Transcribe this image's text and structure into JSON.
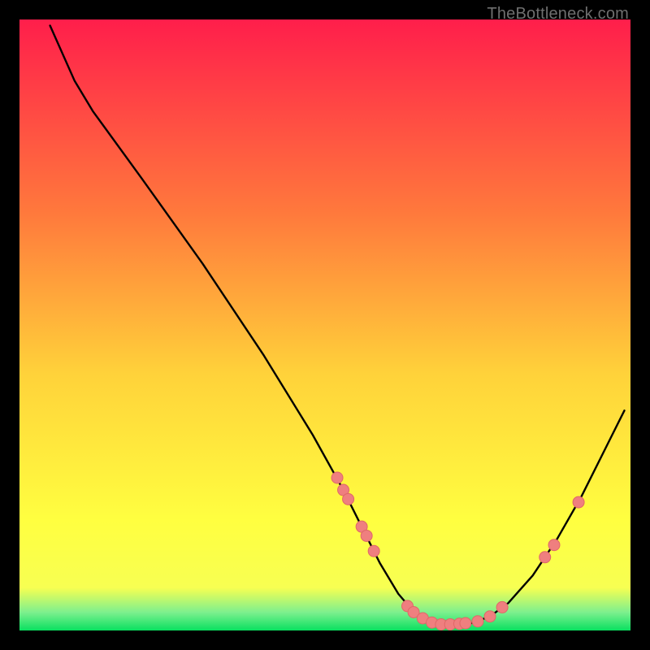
{
  "attribution": "TheBottleneck.com",
  "colors": {
    "top": "#ff1e4b",
    "mid_upper": "#ff7a3c",
    "mid": "#ffd23a",
    "mid_lower": "#ffff40",
    "green": "#09e060",
    "curve": "#000000",
    "marker": "#ef7f7f",
    "marker_stroke": "#e06868",
    "frame_bg": "#000000"
  },
  "chart_data": {
    "type": "line",
    "title": "",
    "xlabel": "",
    "ylabel": "",
    "xlim": [
      0,
      100
    ],
    "ylim": [
      0,
      100
    ],
    "curve": [
      {
        "x": 5.0,
        "y": 99.0
      },
      {
        "x": 9.0,
        "y": 90.0
      },
      {
        "x": 12.0,
        "y": 85.0
      },
      {
        "x": 20.0,
        "y": 74.0
      },
      {
        "x": 30.0,
        "y": 60.0
      },
      {
        "x": 40.0,
        "y": 45.0
      },
      {
        "x": 48.0,
        "y": 32.0
      },
      {
        "x": 53.0,
        "y": 23.0
      },
      {
        "x": 56.0,
        "y": 17.0
      },
      {
        "x": 59.0,
        "y": 11.0
      },
      {
        "x": 62.0,
        "y": 6.0
      },
      {
        "x": 65.0,
        "y": 2.5
      },
      {
        "x": 68.0,
        "y": 1.2
      },
      {
        "x": 71.0,
        "y": 1.0
      },
      {
        "x": 74.0,
        "y": 1.2
      },
      {
        "x": 77.0,
        "y": 2.3
      },
      {
        "x": 80.0,
        "y": 4.5
      },
      {
        "x": 84.0,
        "y": 9.0
      },
      {
        "x": 88.0,
        "y": 15.0
      },
      {
        "x": 92.0,
        "y": 22.0
      },
      {
        "x": 96.0,
        "y": 30.0
      },
      {
        "x": 99.0,
        "y": 36.0
      }
    ],
    "markers": [
      {
        "x": 52.0,
        "y": 25.0
      },
      {
        "x": 53.0,
        "y": 23.0
      },
      {
        "x": 53.8,
        "y": 21.5
      },
      {
        "x": 56.0,
        "y": 17.0
      },
      {
        "x": 56.8,
        "y": 15.5
      },
      {
        "x": 58.0,
        "y": 13.0
      },
      {
        "x": 63.5,
        "y": 4.0
      },
      {
        "x": 64.5,
        "y": 3.0
      },
      {
        "x": 66.0,
        "y": 2.0
      },
      {
        "x": 67.5,
        "y": 1.3
      },
      {
        "x": 69.0,
        "y": 1.0
      },
      {
        "x": 70.5,
        "y": 1.0
      },
      {
        "x": 72.0,
        "y": 1.1
      },
      {
        "x": 73.0,
        "y": 1.2
      },
      {
        "x": 75.0,
        "y": 1.5
      },
      {
        "x": 77.0,
        "y": 2.3
      },
      {
        "x": 79.0,
        "y": 3.8
      },
      {
        "x": 86.0,
        "y": 12.0
      },
      {
        "x": 87.5,
        "y": 14.0
      },
      {
        "x": 91.5,
        "y": 21.0
      }
    ]
  }
}
